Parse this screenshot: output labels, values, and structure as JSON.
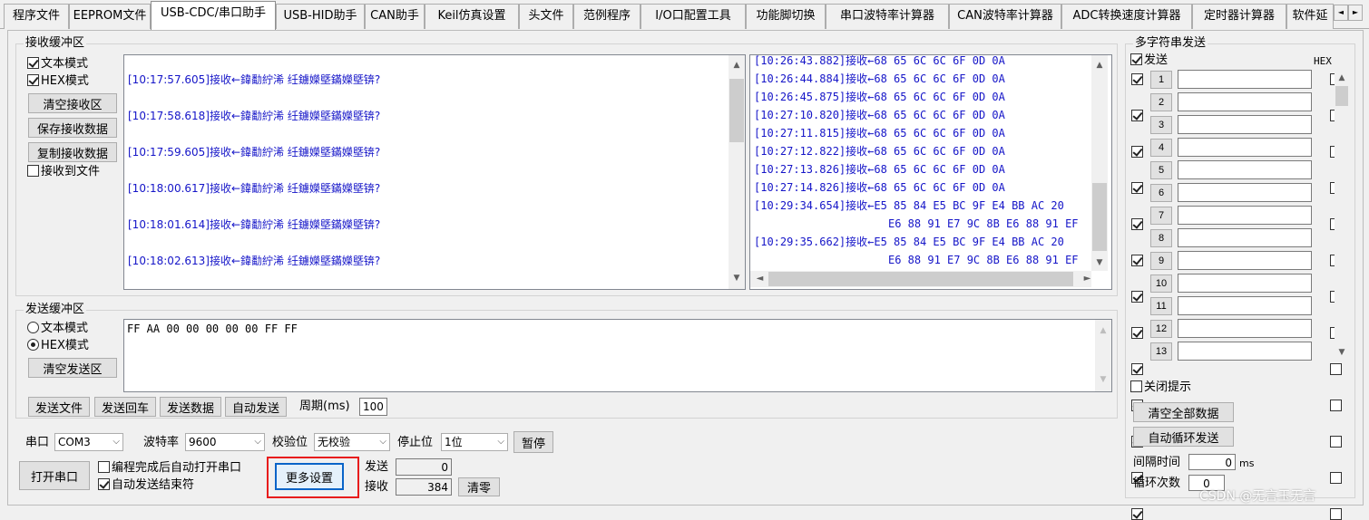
{
  "tabs": [
    "程序文件",
    "EEPROM文件",
    "USB-CDC/串口助手",
    "USB-HID助手",
    "CAN助手",
    "Keil仿真设置",
    "头文件",
    "范例程序",
    "I/O口配置工具",
    "功能脚切换",
    "串口波特率计算器",
    "CAN波特率计算器",
    "ADC转换速度计算器",
    "定时器计算器",
    "软件延"
  ],
  "tab_scroll": {
    "left": "◄",
    "right": "►"
  },
  "recv": {
    "legend": "接收缓冲区",
    "text_mode": "文本模式",
    "hex_mode": "HEX模式",
    "clear_btn": "清空接收区",
    "save_btn": "保存接收数据",
    "copy_btn": "复制接收数据",
    "to_file": "接收到文件",
    "text_lines": [
      "[10:17:57.605]接收←鍏勫紵浠  纴鐪嬫墍鏋嬫墍锛?",
      "[10:17:58.618]接收←鍏勫紵浠  纴鐪嬫墍鏋嬫墍锛?",
      "[10:17:59.605]接收←鍏勫紵浠  纴鐪嬫墍鏋嬫墍锛?",
      "[10:18:00.617]接收←鍏勫紵浠  纴鐪嬫墍鏋嬫墍锛?",
      "[10:18:01.614]接收←鍏勫紵浠  纴鐪嬫墍鏋嬫墍锛?",
      "[10:18:02.613]接收←鍏勫紵浠  纴鐪嬫墍鏋嬫墍锛?"
    ],
    "hex_lines": [
      "[10:26:43.882]接收←68 65 6C 6C 6F 0D 0A",
      "[10:26:44.884]接收←68 65 6C 6C 6F 0D 0A",
      "[10:26:45.875]接收←68 65 6C 6C 6F 0D 0A",
      "[10:27:10.820]接收←68 65 6C 6C 6F 0D 0A",
      "[10:27:11.815]接收←68 65 6C 6C 6F 0D 0A",
      "[10:27:12.822]接收←68 65 6C 6C 6F 0D 0A",
      "[10:27:13.826]接收←68 65 6C 6C 6F 0D 0A",
      "[10:27:14.826]接收←68 65 6C 6C 6F 0D 0A",
      "[10:29:34.654]接收←E5 85 84 E5 BC 9F E4 BB AC 20",
      "E6 88 91 E7 9C 8B E6 88 91 EF",
      "[10:29:35.662]接收←E5 85 84 E5 BC 9F E4 BB AC 20",
      "E6 88 91 E7 9C 8B E6 88 91 EF"
    ]
  },
  "send": {
    "legend": "发送缓冲区",
    "text_mode": "文本模式",
    "hex_mode": "HEX模式",
    "clear_btn": "清空发送区",
    "content": "FF AA 00 00 00 00 00 FF FF",
    "send_file": "发送文件",
    "send_enter": "发送回车",
    "send_data": "发送数据",
    "auto_send": "自动发送",
    "period_label": "周期(ms)",
    "period": "100"
  },
  "serial": {
    "port_label": "串口",
    "port": "COM3",
    "baud_label": "波特率",
    "baud": "9600",
    "parity_label": "校验位",
    "parity": "无校验",
    "stop_label": "停止位",
    "stop": "1位",
    "pause_btn": "暂停",
    "open_btn": "打开串口",
    "auto_open": "编程完成后自动打开串口",
    "auto_end": "自动发送结束符",
    "more_btn": "更多设置",
    "sent_label": "发送",
    "sent": "0",
    "recv_label": "接收",
    "recv": "384",
    "clear_btn": "清零"
  },
  "multi": {
    "legend": "多字符串发送",
    "send_header": "发送",
    "hex_header": "HEX",
    "rows": [
      "1",
      "2",
      "3",
      "4",
      "5",
      "6",
      "7",
      "8",
      "9",
      "10",
      "11",
      "12",
      "13"
    ],
    "close_tip": "关闭提示",
    "clear_all": "清空全部数据",
    "auto_loop": "自动循环发送",
    "interval_label": "间隔时间",
    "interval": "0",
    "interval_unit": "ms",
    "loop_label": "循环次数",
    "loop": "0"
  },
  "watermark": "CSDN @无言玉无言"
}
